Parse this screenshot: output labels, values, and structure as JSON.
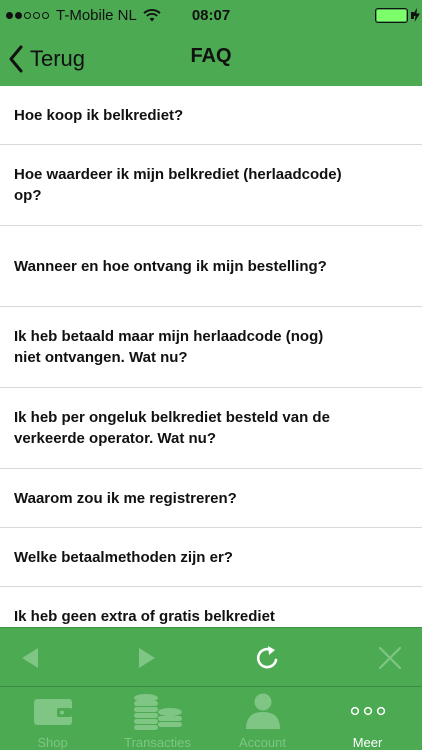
{
  "status_bar": {
    "carrier": "T-Mobile NL",
    "time": "08:07",
    "signal_bars_filled": 2,
    "signal_bars_total": 5
  },
  "nav": {
    "back_label": "Terug",
    "title": "FAQ"
  },
  "faq": {
    "items": [
      {
        "q": "Hoe koop ik belkrediet?"
      },
      {
        "q": "Hoe waardeer ik mijn belkrediet (herlaadcode) op?"
      },
      {
        "q": "Wanneer en hoe ontvang ik mijn bestelling?"
      },
      {
        "q": "Ik heb betaald maar mijn herlaadcode (nog) niet ontvangen. Wat nu?"
      },
      {
        "q": "Ik heb per ongeluk belkrediet besteld van de verkeerde operator. Wat nu?"
      },
      {
        "q": "Waarom zou ik me registreren?"
      },
      {
        "q": "Welke betaalmethoden zijn er?"
      },
      {
        "q": "Ik heb geen extra of gratis belkrediet"
      }
    ]
  },
  "toolbar": {
    "icons": [
      "arrow-left-icon",
      "arrow-right-icon",
      "refresh-icon",
      "close-icon"
    ]
  },
  "tabs": {
    "items": [
      {
        "label": "Shop",
        "icon": "wallet-icon"
      },
      {
        "label": "Transacties",
        "icon": "coins-icon"
      },
      {
        "label": "Account",
        "icon": "user-icon"
      },
      {
        "label": "Meer",
        "icon": "more-dots-icon"
      }
    ],
    "active_index": 3
  },
  "colors": {
    "brand_green": "#4caa52",
    "battery_green": "#7cff6a",
    "inactive_tab": "#7fc583"
  }
}
